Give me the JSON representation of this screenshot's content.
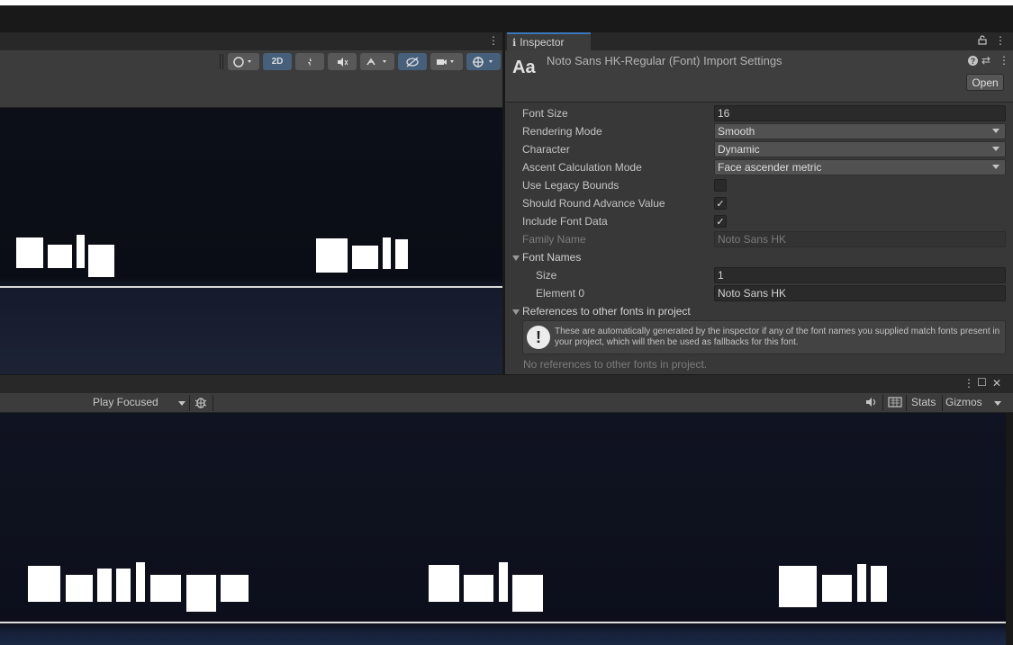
{
  "scene": {
    "menu_dots": "⋮",
    "toolbar": {
      "mode_2d": "2D"
    },
    "texts": [
      {
        "name": "scene-text-help",
        "label": "Help"
      },
      {
        "name": "scene-text-quit",
        "label": "Quit"
      }
    ]
  },
  "inspector": {
    "tab_icon": "ℹ",
    "tab_label": "Inspector",
    "lock_icon": "🔒",
    "menu_dots": "⋮",
    "header_icon": "Aa",
    "title": "Noto Sans HK-Regular (Font) Import Settings",
    "help_icon": "?",
    "preset_icon": "⇄",
    "open_button": "Open",
    "properties": {
      "font_size": {
        "label": "Font Size",
        "value": "16"
      },
      "rendering_mode": {
        "label": "Rendering Mode",
        "value": "Smooth"
      },
      "character": {
        "label": "Character",
        "value": "Dynamic"
      },
      "ascent_mode": {
        "label": "Ascent Calculation Mode",
        "value": "Face ascender metric"
      },
      "use_legacy_bounds": {
        "label": "Use Legacy Bounds",
        "checked": false
      },
      "round_advance": {
        "label": "Should Round Advance Value",
        "checked": true,
        "mark": "✓"
      },
      "include_font_data": {
        "label": "Include Font Data",
        "checked": true,
        "mark": "✓"
      },
      "family_name": {
        "label": "Family Name",
        "value": "Noto Sans HK"
      }
    },
    "font_names": {
      "label": "Font Names",
      "size_label": "Size",
      "size_value": "1",
      "element0_label": "Element 0",
      "element0_value": "Noto Sans HK"
    },
    "references": {
      "label": "References to other fonts in project",
      "help_icon": "!",
      "help_text": "These are automatically generated by the inspector if any of the font names you supplied match fonts present in your project, which will then be used as fallbacks for this font.",
      "none_text": "No references to other fonts in project."
    }
  },
  "game": {
    "tab_icons": {
      "menu": "⋮",
      "maximize": "☐",
      "close": "✕"
    },
    "play_focused": "Play Focused",
    "bug_icon": "🐞",
    "audio_icon": "🔊",
    "keyboard_icon": "⌨",
    "stats": "Stats",
    "gizmos": "Gizmos",
    "texts": [
      {
        "name": "game-text-settings",
        "label": "Settings"
      },
      {
        "name": "game-text-help",
        "label": "Help"
      },
      {
        "name": "game-text-quit",
        "label": "Quit"
      }
    ]
  }
}
